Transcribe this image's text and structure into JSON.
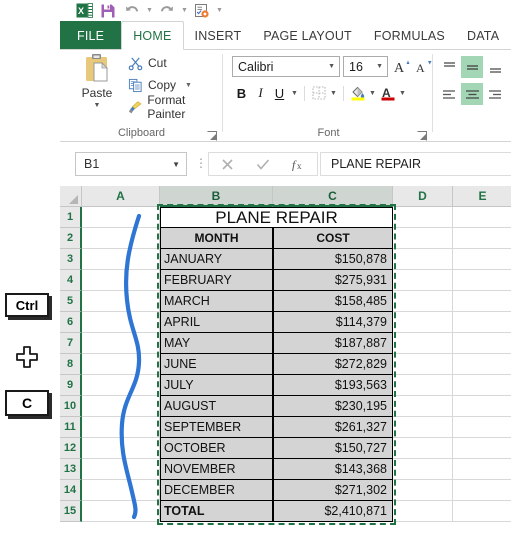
{
  "quick_access": {
    "items": [
      {
        "name": "excel-logo-icon",
        "label": "X"
      },
      {
        "name": "save-icon",
        "label": "Save"
      },
      {
        "name": "undo-icon",
        "label": "Undo"
      },
      {
        "name": "redo-icon",
        "label": "Redo"
      },
      {
        "name": "quick-print-icon",
        "label": "Custom Quick Access"
      },
      {
        "name": "customize-qat-icon",
        "label": "Customize Quick Access Toolbar"
      }
    ]
  },
  "ribbon": {
    "tabs": [
      {
        "label": "FILE",
        "active": false,
        "file": true
      },
      {
        "label": "HOME",
        "active": true,
        "file": false
      },
      {
        "label": "INSERT",
        "active": false,
        "file": false
      },
      {
        "label": "PAGE LAYOUT",
        "active": false,
        "file": false
      },
      {
        "label": "FORMULAS",
        "active": false,
        "file": false
      },
      {
        "label": "DATA",
        "active": false,
        "file": false
      }
    ],
    "clipboard": {
      "group_label": "Clipboard",
      "paste_label": "Paste",
      "cut_label": "Cut",
      "copy_label": "Copy",
      "format_painter_label": "Format Painter"
    },
    "font": {
      "group_label": "Font",
      "font_name": "Calibri",
      "font_size": "16",
      "grow_font_label": "A",
      "shrink_font_label": "A",
      "bold_label": "B",
      "italic_label": "I",
      "underline_label": "U"
    },
    "alignment": {
      "top_align_label": "Top Align",
      "middle_align_label": "Middle Align",
      "bottom_align_label": "Bottom Align",
      "align_left_label": "Align Left",
      "center_label": "Center",
      "align_right_label": "Align Right"
    }
  },
  "formula_bar": {
    "name_box_value": "B1",
    "cancel_label": "✕",
    "enter_label": "✓",
    "insert_function_label": "fx",
    "formula_value": "PLANE REPAIR"
  },
  "annotation": {
    "key1": "Ctrl",
    "key2": "C",
    "plus": "+"
  },
  "sheet": {
    "columns": [
      "A",
      "B",
      "C",
      "D",
      "E"
    ],
    "selected_columns": [
      "B",
      "C"
    ],
    "rows": [
      "1",
      "2",
      "3",
      "4",
      "5",
      "6",
      "7",
      "8",
      "9",
      "10",
      "11",
      "12",
      "13",
      "14",
      "15"
    ],
    "title": "PLANE REPAIR",
    "headers": [
      "MONTH",
      "COST"
    ],
    "data": [
      {
        "month": "JANUARY",
        "cost": "$150,878"
      },
      {
        "month": "FEBRUARY",
        "cost": "$275,931"
      },
      {
        "month": "MARCH",
        "cost": "$158,485"
      },
      {
        "month": "APRIL",
        "cost": "$114,379"
      },
      {
        "month": "MAY",
        "cost": "$187,887"
      },
      {
        "month": "JUNE",
        "cost": "$272,829"
      },
      {
        "month": "JULY",
        "cost": "$193,563"
      },
      {
        "month": "AUGUST",
        "cost": "$230,195"
      },
      {
        "month": "SEPTEMBER",
        "cost": "$261,327"
      },
      {
        "month": "OCTOBER",
        "cost": "$150,727"
      },
      {
        "month": "NOVEMBER",
        "cost": "$143,368"
      },
      {
        "month": "DECEMBER",
        "cost": "$271,302"
      }
    ],
    "total_label": "TOTAL",
    "total_value": "$2,410,871"
  },
  "colors": {
    "excel_green": "#217346",
    "selection_green": "#217346",
    "cell_fill_gray": "#d4d4d4",
    "annotation_blue": "#2e75d4",
    "ribbon_highlight": "#a2d6b4"
  }
}
